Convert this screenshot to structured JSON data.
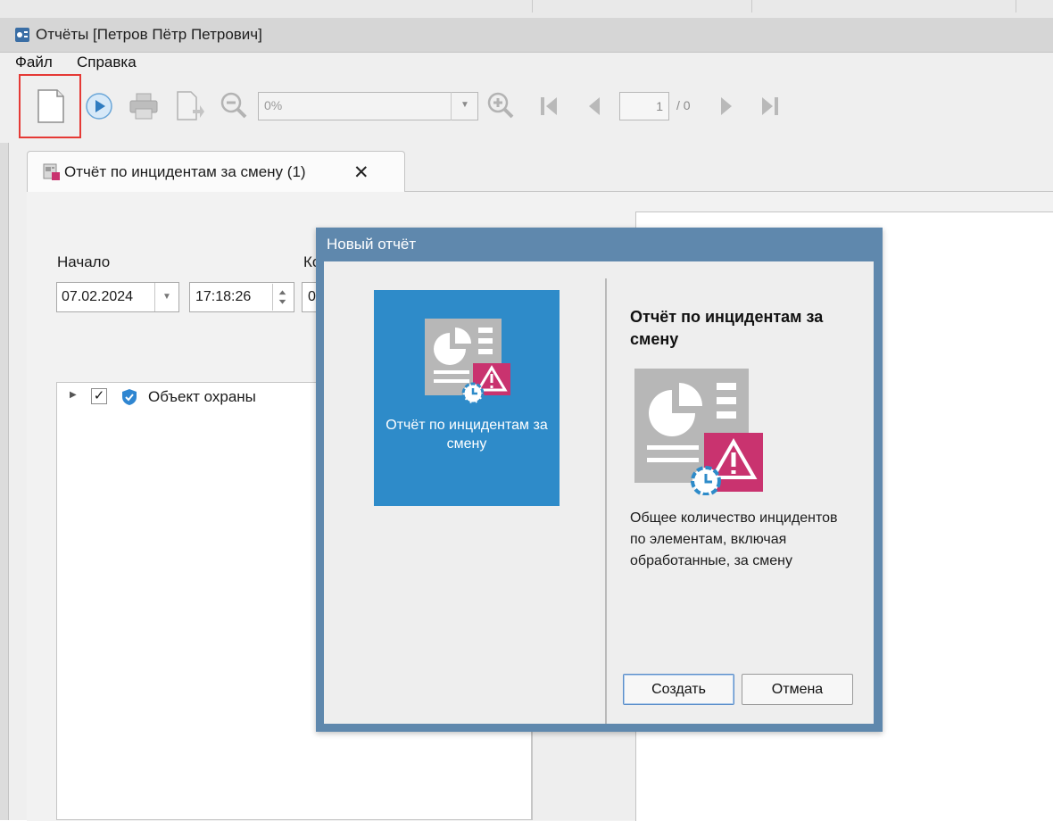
{
  "window": {
    "title": "Отчёты [Петров Пётр Петрович]"
  },
  "menu": {
    "items": [
      "Файл",
      "Справка"
    ]
  },
  "toolbar": {
    "buttons": [
      "new-report-icon",
      "run-icon",
      "print-icon",
      "export-icon",
      "zoom-out-icon",
      "zoom-in-icon",
      "first-page-icon",
      "previous-page-icon",
      "next-page-icon",
      "last-page-icon"
    ],
    "zoom_value": "0%",
    "page_current": "1",
    "page_total": "/ 0"
  },
  "tab": {
    "label": "Отчёт по инцидентам за смену (1)"
  },
  "params": {
    "start_label": "Начало",
    "end_label": "Ко",
    "start_date": "07.02.2024",
    "start_time": "17:18:26",
    "end_date": "0"
  },
  "tree": {
    "items": [
      {
        "label": "Объект охраны",
        "checked": true
      }
    ]
  },
  "dialog": {
    "title": "Новый отчёт",
    "tile_label": "Отчёт по инцидентам за смену",
    "detail_title": "Отчёт по инцидентам за смену",
    "detail_description": "Общее количество инцидентов по элементам, включая обработанные, за смену",
    "create_label": "Создать",
    "cancel_label": "Отмена"
  },
  "colors": {
    "dialog_frame": "#5f88ad",
    "tile": "#2e8bc9",
    "warning_badge": "#c9336f",
    "highlight": "#e53935"
  }
}
